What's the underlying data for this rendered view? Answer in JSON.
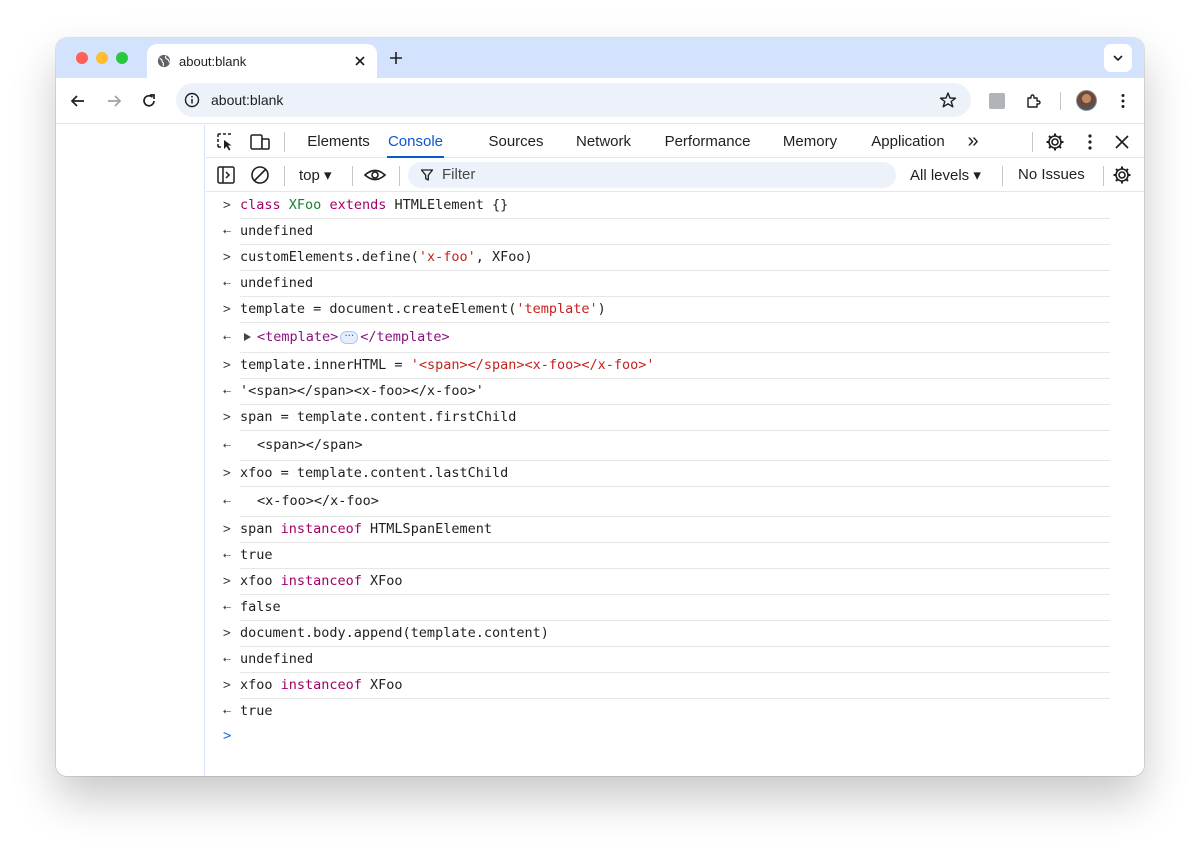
{
  "browser": {
    "tab_title": "about:blank",
    "url": "about:blank"
  },
  "devtools": {
    "tabs": [
      "Elements",
      "Console",
      "Sources",
      "Network",
      "Performance",
      "Memory",
      "Application"
    ],
    "active_tab": "Console",
    "more_tabs": "»",
    "context": "top ▾",
    "filter_placeholder": "Filter",
    "levels": "All levels ▾",
    "issues": "No Issues"
  },
  "console": {
    "r1": {
      "a": "class",
      "b": "XFoo",
      "c": "extends",
      "d": "HTMLElement {}"
    },
    "r2": "undefined",
    "r3": {
      "a": "customElements.define(",
      "b": "'x-foo'",
      "c": ", XFoo)"
    },
    "r4": "undefined",
    "r5": {
      "a": "template = document.createElement(",
      "b": "'template'",
      "c": ")"
    },
    "r6": {
      "a": "<template>",
      "b": "···",
      "c": "</template>"
    },
    "r7": {
      "a": "template.innerHTML = ",
      "b": "'<span></span><x-foo></x-foo>'"
    },
    "r8": "'<span></span><x-foo></x-foo>'",
    "r9": "span = template.content.firstChild",
    "r10": "<span></span>",
    "r11": "xfoo = template.content.lastChild",
    "r12": "<x-foo></x-foo>",
    "r13": {
      "a": "span ",
      "b": "instanceof",
      "c": " HTMLSpanElement"
    },
    "r14": "true",
    "r15": {
      "a": "xfoo ",
      "b": "instanceof",
      "c": " XFoo"
    },
    "r16": "false",
    "r17": "document.body.append(template.content)",
    "r18": "undefined",
    "r19": {
      "a": "xfoo ",
      "b": "instanceof",
      "c": " XFoo"
    },
    "r20": "true"
  }
}
